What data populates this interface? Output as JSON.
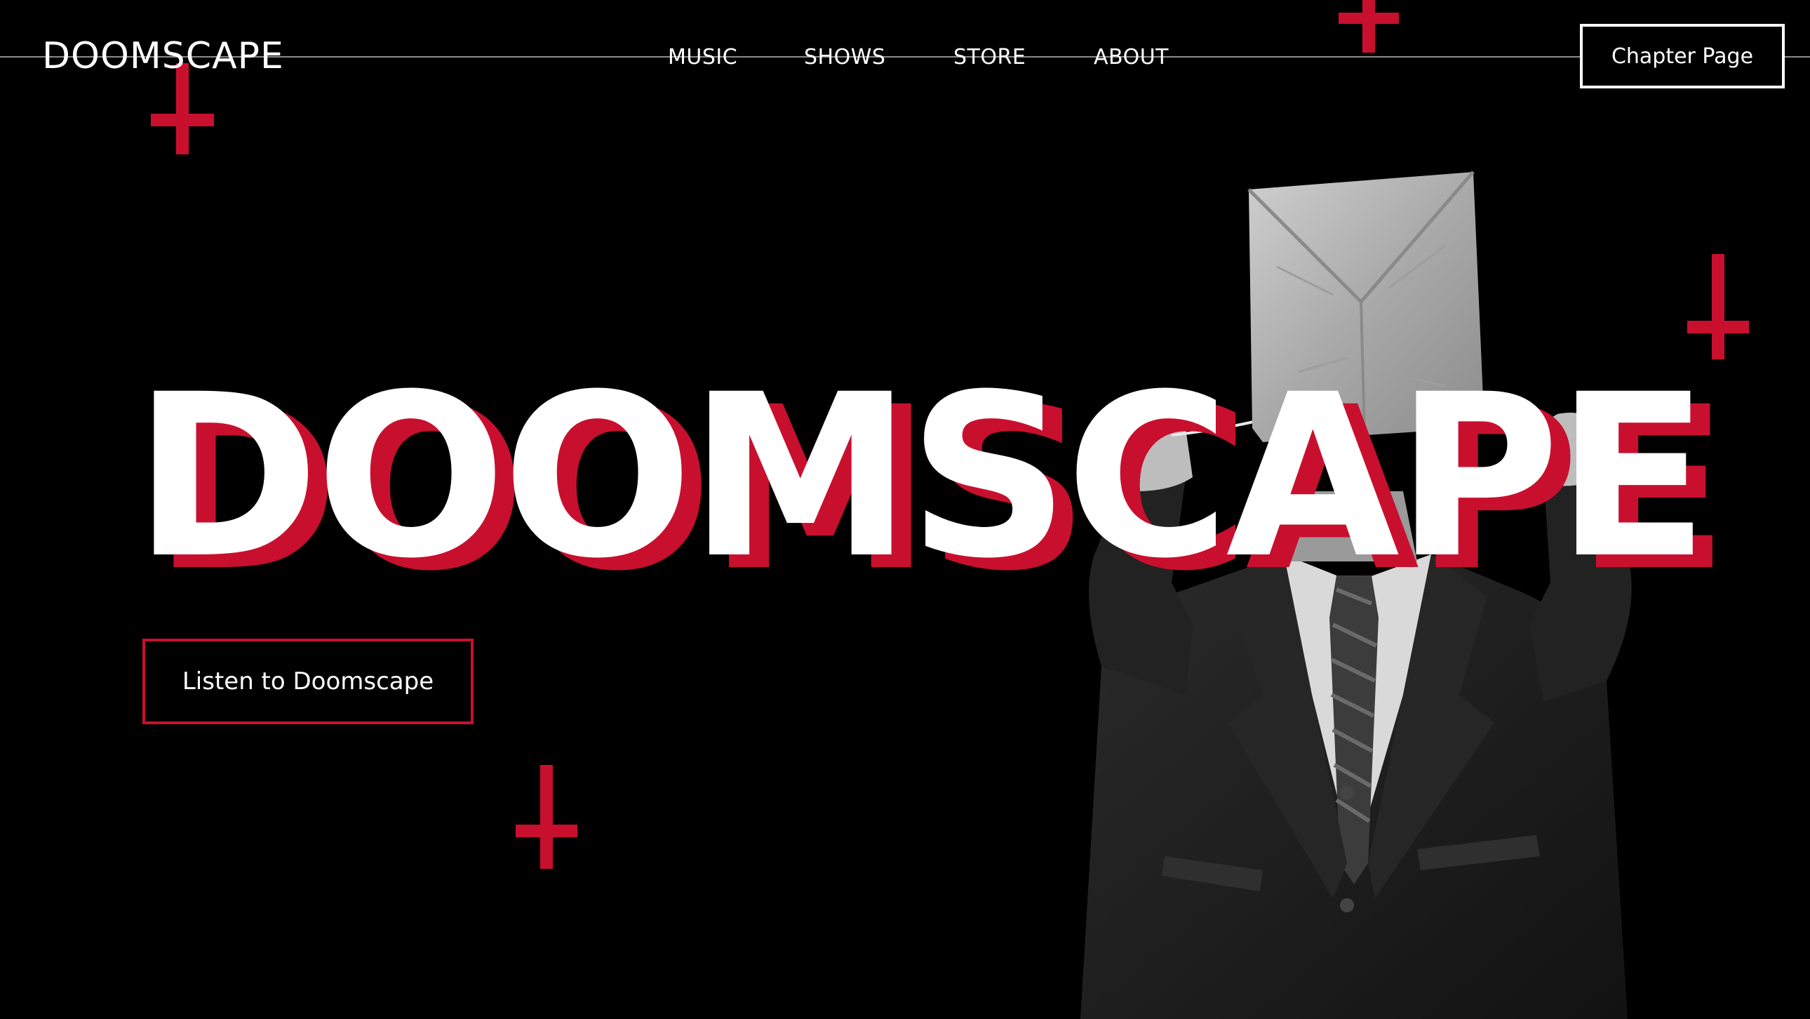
{
  "header": {
    "logo": "DOOMSCAPE",
    "nav": [
      {
        "label": "MUSIC"
      },
      {
        "label": "SHOWS"
      },
      {
        "label": "STORE"
      },
      {
        "label": "ABOUT"
      }
    ],
    "chapter_button": "Chapter Page"
  },
  "hero": {
    "title": "DOOMSCAPE",
    "cta_button": "Listen to Doomscape"
  },
  "colors": {
    "background": "#000000",
    "accent": "#c8102e",
    "text": "#ffffff"
  },
  "icons": [
    "inverted-cross-icon"
  ]
}
